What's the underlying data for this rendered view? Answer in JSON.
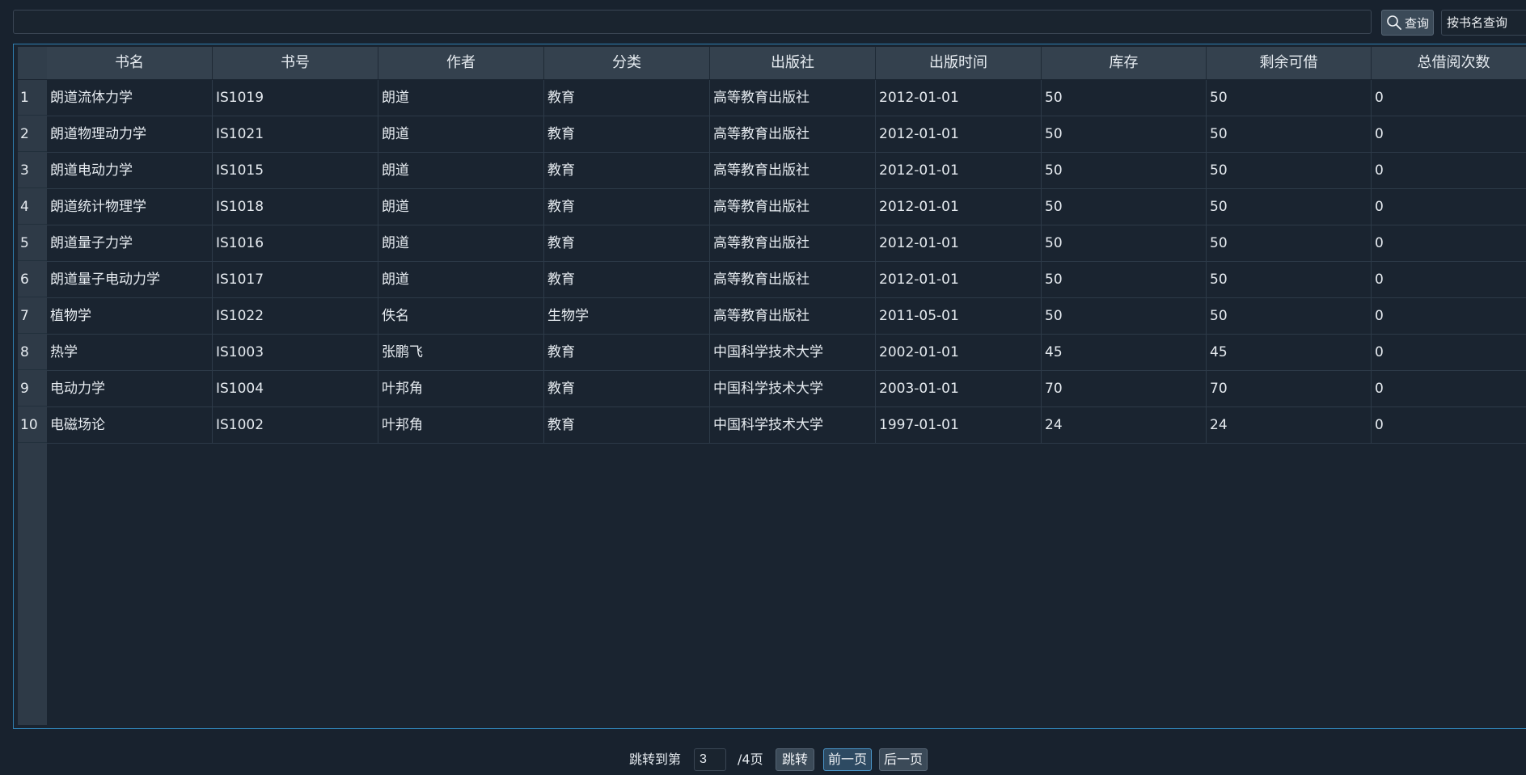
{
  "search": {
    "value": "",
    "placeholder": "",
    "button_label": "查询",
    "mode_label": "按书名查询"
  },
  "table": {
    "columns": [
      "书名",
      "书号",
      "作者",
      "分类",
      "出版社",
      "出版时间",
      "库存",
      "剩余可借",
      "总借阅次数"
    ],
    "row_numbers": [
      "1",
      "2",
      "3",
      "4",
      "5",
      "6",
      "7",
      "8",
      "9",
      "10"
    ],
    "rows": [
      [
        "朗道流体力学",
        "IS1019",
        "朗道",
        "教育",
        "高等教育出版社",
        "2012-01-01",
        "50",
        "50",
        "0"
      ],
      [
        "朗道物理动力学",
        "IS1021",
        "朗道",
        "教育",
        "高等教育出版社",
        "2012-01-01",
        "50",
        "50",
        "0"
      ],
      [
        "朗道电动力学",
        "IS1015",
        "朗道",
        "教育",
        "高等教育出版社",
        "2012-01-01",
        "50",
        "50",
        "0"
      ],
      [
        "朗道统计物理学",
        "IS1018",
        "朗道",
        "教育",
        "高等教育出版社",
        "2012-01-01",
        "50",
        "50",
        "0"
      ],
      [
        "朗道量子力学",
        "IS1016",
        "朗道",
        "教育",
        "高等教育出版社",
        "2012-01-01",
        "50",
        "50",
        "0"
      ],
      [
        "朗道量子电动力学",
        "IS1017",
        "朗道",
        "教育",
        "高等教育出版社",
        "2012-01-01",
        "50",
        "50",
        "0"
      ],
      [
        "植物学",
        "IS1022",
        "佚名",
        "生物学",
        "高等教育出版社",
        "2011-05-01",
        "50",
        "50",
        "0"
      ],
      [
        "热学",
        "IS1003",
        "张鹏飞",
        "教育",
        "中国科学技术大学",
        "2002-01-01",
        "45",
        "45",
        "0"
      ],
      [
        "电动力学",
        "IS1004",
        "叶邦角",
        "教育",
        "中国科学技术大学",
        "2003-01-01",
        "70",
        "70",
        "0"
      ],
      [
        "电磁场论",
        "IS1002",
        "叶邦角",
        "教育",
        "中国科学技术大学",
        "1997-01-01",
        "24",
        "24",
        "0"
      ]
    ]
  },
  "pager": {
    "jump_label": "跳转到第",
    "page_value": "3",
    "total_label": "/4页",
    "jump_button": "跳转",
    "prev_button": "前一页",
    "next_button": "后一页"
  },
  "colors": {
    "background": "#18222e",
    "header_bg": "#34414e",
    "panel_border": "#2f7fb0",
    "button_bg": "#3b4a58"
  },
  "icons": {
    "search": "search-icon"
  }
}
